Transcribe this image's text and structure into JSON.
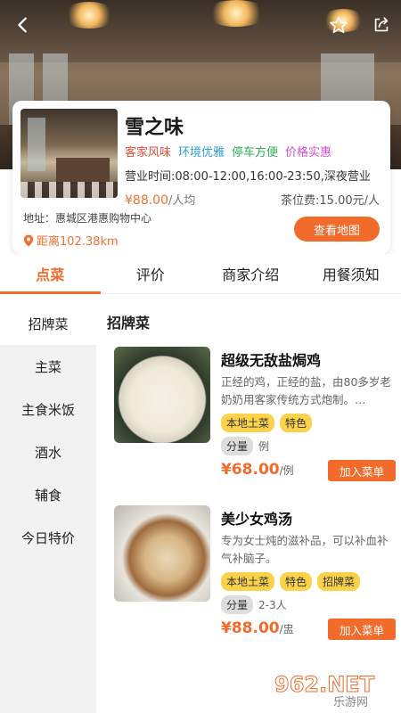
{
  "header": {
    "back_icon": "chevron-left-icon",
    "favorite_icon": "star-icon",
    "share_icon": "share-icon"
  },
  "restaurant": {
    "name": "雪之味",
    "tags": [
      "客家风味",
      "环境优雅",
      "停车方便",
      "价格实惠"
    ],
    "tag_colors": [
      "#e74c3c",
      "#2f9fd8",
      "#2fb35a",
      "#d24fd2"
    ],
    "hours": "营业时间:08:00-12:00,16:00-23:50,深夜营业",
    "price": "¥88.00",
    "price_unit": "/人均",
    "tea_fee": "茶位费:15.00元/人",
    "address": "地址：惠城区港惠购物中心",
    "distance": "距离102.38km",
    "map_button": "查看地图"
  },
  "tabs": [
    {
      "label": "点菜",
      "active": true
    },
    {
      "label": "评价",
      "active": false
    },
    {
      "label": "商家介绍",
      "active": false
    },
    {
      "label": "用餐须知",
      "active": false
    }
  ],
  "sidebar": {
    "items": [
      {
        "label": "招牌菜",
        "active": true
      },
      {
        "label": "主菜",
        "active": false
      },
      {
        "label": "主食米饭",
        "active": false
      },
      {
        "label": "酒水",
        "active": false
      },
      {
        "label": "辅食",
        "active": false
      },
      {
        "label": "今日特价",
        "active": false
      }
    ]
  },
  "menu": {
    "section_title": "招牌菜",
    "dishes": [
      {
        "name": "超级无敌盐焗鸡",
        "description": "正经的鸡，正经的盐，由80多岁老奶奶用客家传统方式炮制。…",
        "tags": [
          "本地土菜",
          "特色"
        ],
        "spec_label": "分量",
        "spec_value": "例",
        "price": "¥68.00",
        "price_unit": "/例",
        "add_label": "加入菜单"
      },
      {
        "name": "美少女鸡汤",
        "description": "专为女士炖的滋补品，可以补血补气补脑子。",
        "tags": [
          "本地土菜",
          "特色",
          "招牌菜"
        ],
        "spec_label": "分量",
        "spec_value": "2-3人",
        "price": "¥88.00",
        "price_unit": "/盅",
        "add_label": "加入菜单"
      }
    ]
  },
  "watermark": {
    "main": "962.NET",
    "sub": "乐游网"
  },
  "theme": {
    "accent": "#f26b2b",
    "tag_yellow": "#fbd24a"
  }
}
